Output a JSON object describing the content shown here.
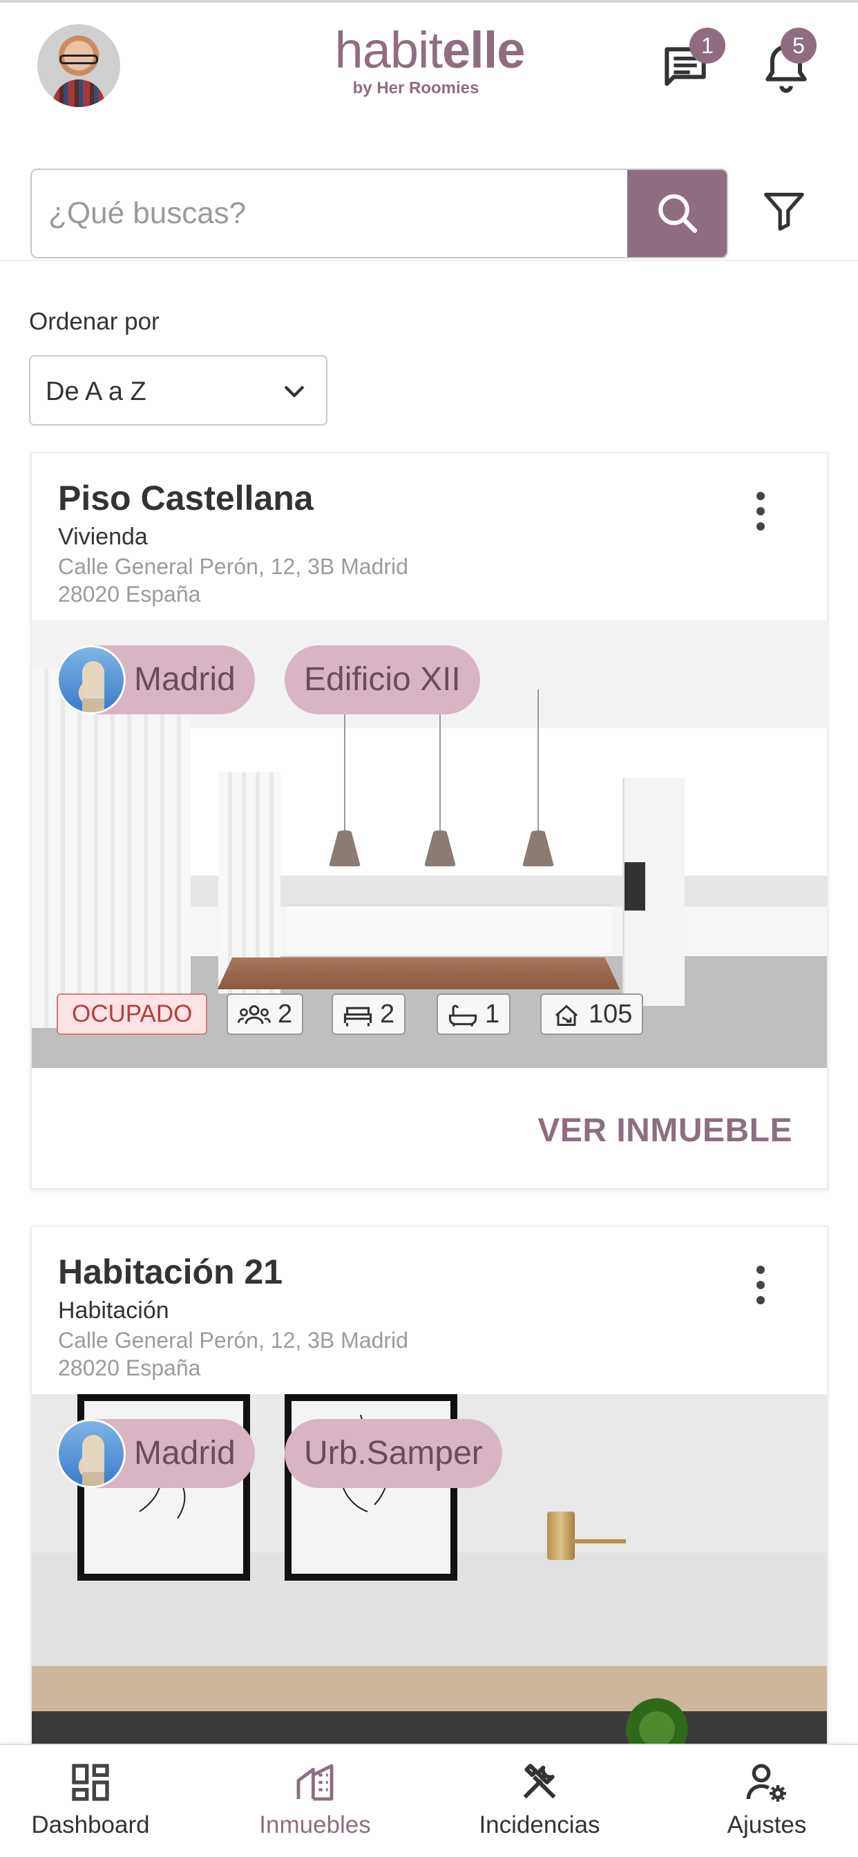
{
  "header": {
    "logo_main_a": "habit",
    "logo_main_b": "elle",
    "logo_sub": "by Her Roomies",
    "chat_badge": "1",
    "notif_badge": "5"
  },
  "search": {
    "placeholder": "¿Qué buscas?"
  },
  "sort": {
    "label": "Ordenar por",
    "value": "De A a Z"
  },
  "properties": [
    {
      "title": "Piso Castellana",
      "type": "Vivienda",
      "address_line1": "Calle General Perón, 12, 3B Madrid",
      "address_line2": "28020 España",
      "city_chip": "Madrid",
      "building_chip": "Edificio XII",
      "status": "OCUPADO",
      "people": "2",
      "beds": "2",
      "baths": "1",
      "area": "105",
      "action": "VER INMUEBLE"
    },
    {
      "title": "Habitación 21",
      "type": "Habitación",
      "address_line1": "Calle General Perón, 12, 3B Madrid",
      "address_line2": "28020 España",
      "city_chip": "Madrid",
      "building_chip": "Urb.Samper"
    }
  ],
  "nav": {
    "dashboard": "Dashboard",
    "inmuebles": "Inmuebles",
    "incidencias": "Incidencias",
    "ajustes": "Ajustes",
    "active": "inmuebles"
  },
  "colors": {
    "brand": "#8f6d81",
    "chip": "#d8b5c4",
    "status_bg": "#fde3e3",
    "status_text": "#b3403f"
  }
}
